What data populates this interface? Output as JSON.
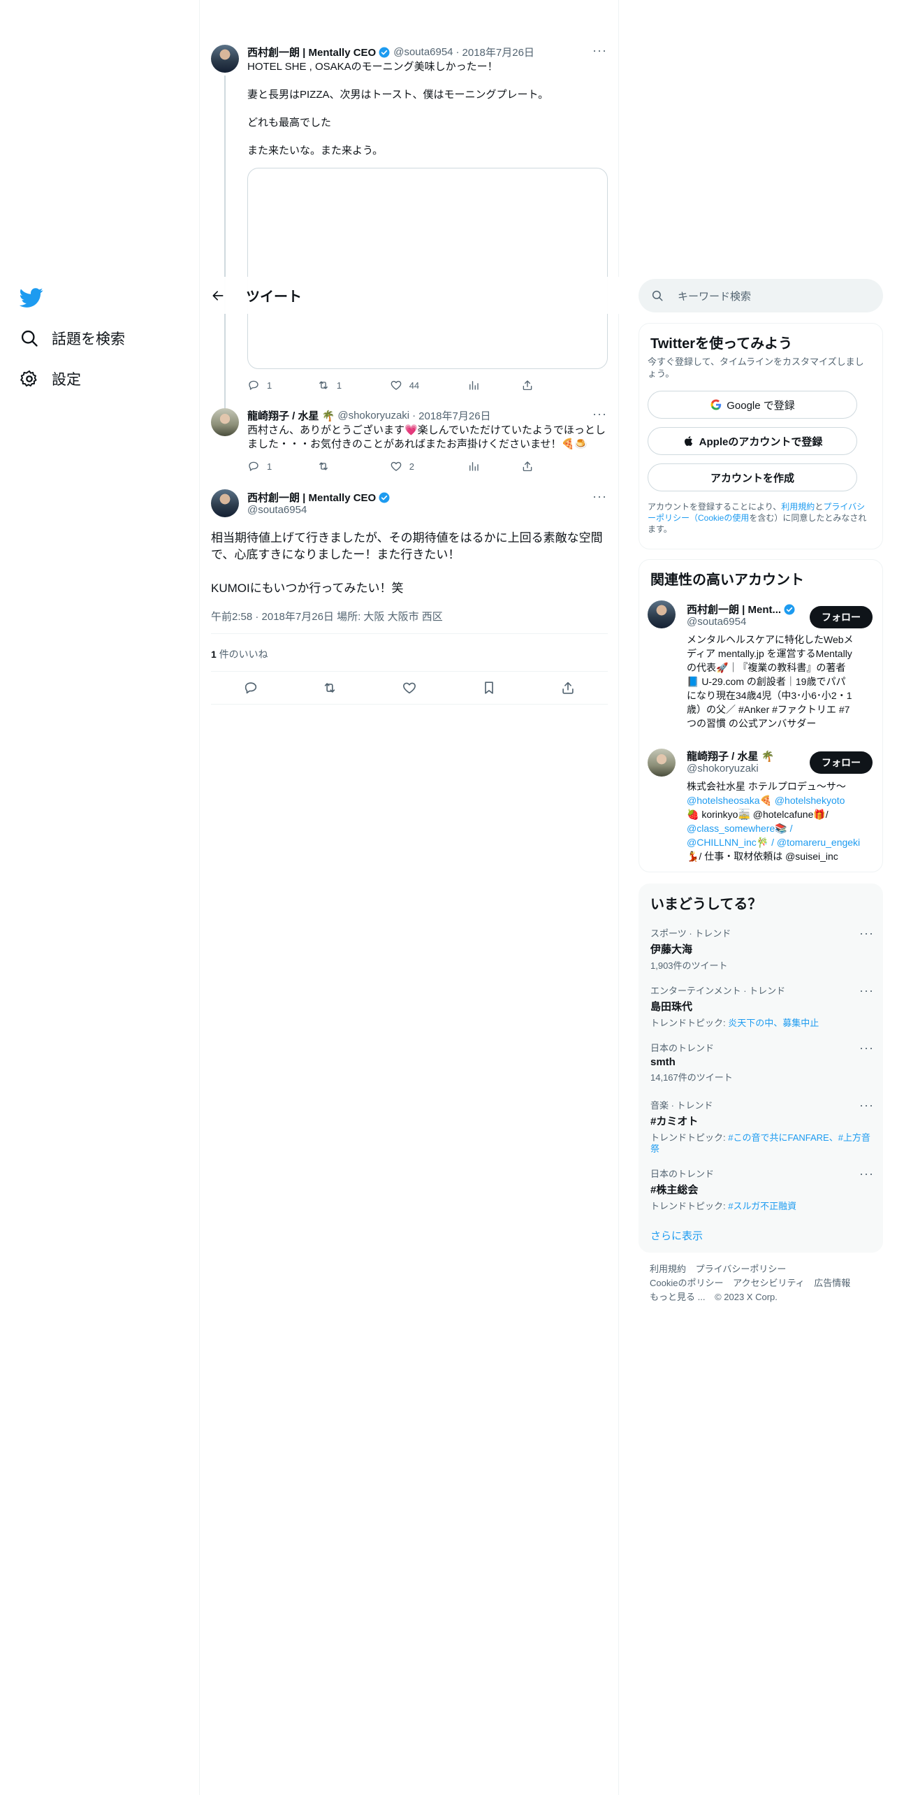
{
  "nav": {
    "items": [
      {
        "label": "話題を検索"
      },
      {
        "label": "設定"
      }
    ]
  },
  "header": {
    "title": "ツイート"
  },
  "parent_tweet": {
    "name": "西村創一朗 | Mentally CEO",
    "handle": "@souta6954",
    "date": "2018年7月26日",
    "lines": [
      "HOTEL SHE , OSAKAのモーニング美味しかったー！",
      "妻と長男はPIZZA、次男はトースト、僕はモーニングプレート。",
      "どれも最高でした",
      "また来たいな。また来よう。"
    ],
    "replies": "1",
    "retweets": "1",
    "likes": "44"
  },
  "reply_tweet": {
    "name": "龍崎翔子 / 水星 🌴",
    "handle": "@shokoryuzaki",
    "date": "2018年7月26日",
    "text": "西村さん、ありがとうございます💗楽しんでいただけていたようでほっとしました・・・お気付きのことがあればまたお声掛けくださいませ！🍕🍮",
    "replies": "1",
    "retweets": "",
    "likes": "2"
  },
  "focus_tweet": {
    "name": "西村創一朗 | Mentally CEO",
    "handle": "@souta6954",
    "text1": "相当期待値上げて行きましたが、その期待値をはるかに上回る素敵な空間で、心底すきになりましたー！また行きたい！",
    "text2": "KUMOIにもいつか行ってみたい！笑",
    "meta": "午前2:58 · 2018年7月26日 場所: 大阪 大阪市 西区",
    "likes_count": "1",
    "likes_label": "件のいいね"
  },
  "search": {
    "placeholder": "キーワード検索"
  },
  "signup": {
    "title": "Twitterを使ってみよう",
    "desc": "今すぐ登録して、タイムラインをカスタマイズしましょう。",
    "google": "Google で登録",
    "apple": "Appleのアカウントで登録",
    "create": "アカウントを作成",
    "legal_pre": "アカウントを登録することにより、",
    "legal_tos": "利用規約",
    "legal_and": "と",
    "legal_pp": "プライバシーポリシー（Cookieの使用",
    "legal_post": "を含む）に同意したとみなされます。"
  },
  "relevant": {
    "title": "関連性の高いアカウント",
    "accounts": [
      {
        "name": "西村創一朗 | Ment...",
        "handle": "@souta6954",
        "follow": "フォロー",
        "bio_lines": [
          "メンタルヘルスケアに特化したWebメ",
          "ディア mentally.jp を運営するMentally",
          "の代表🚀｜『複業の教科書』の著者",
          "📘 U-29.com の創設者｜19歳でパパ",
          "になり現在34歳4児（中3･小6･小2・1",
          "歳）の父／ #Anker #ファクトリエ #7",
          "つの習慣 の公式アンバサダー"
        ]
      },
      {
        "name": "龍崎翔子 / 水星 🌴",
        "handle": "@shokoryuzaki",
        "follow": "フォロー",
        "bio_lines": [
          "株式会社水星 ホテルプロデュ〜サ〜",
          "@hotelsheosaka🍕 @hotelshekyoto",
          "🍓 korinkyo🚋 @hotelcafune🎁/",
          "@class_somewhere📚 /",
          "@CHILLNN_inc🎋 / @tomareru_engeki",
          "💃/ 仕事・取材依頼は @suisei_inc"
        ]
      }
    ]
  },
  "trends": {
    "title": "いまどうしてる？",
    "items": [
      {
        "category": "スポーツ · トレンド",
        "name": "伊藤大海",
        "sub": "1,903件のツイート"
      },
      {
        "category": "エンターテインメント · トレンド",
        "name": "島田珠代",
        "sub_prefix": "トレンドトピック: ",
        "sub_link": "炎天下の中、募集中止"
      },
      {
        "category": "日本のトレンド",
        "name": "smth",
        "sub": "14,167件のツイート"
      },
      {
        "category": "音楽 · トレンド",
        "name": "#カミオト",
        "sub_prefix": "トレンドトピック: ",
        "sub_link": "#この音で共にFANFARE、#上方音祭"
      },
      {
        "category": "日本のトレンド",
        "name": "#株主総会",
        "sub_prefix": "トレンドトピック: ",
        "sub_link": "#スルガ不正融資"
      }
    ],
    "show_more": "さらに表示"
  },
  "footer": {
    "tos": "利用規約",
    "privacy": "プライバシーポリシー",
    "cookie": "Cookieのポリシー",
    "accessibility": "アクセシビリティ",
    "ads": "広告情報",
    "more": "もっと見る ...",
    "copyright": "© 2023 X Corp."
  }
}
